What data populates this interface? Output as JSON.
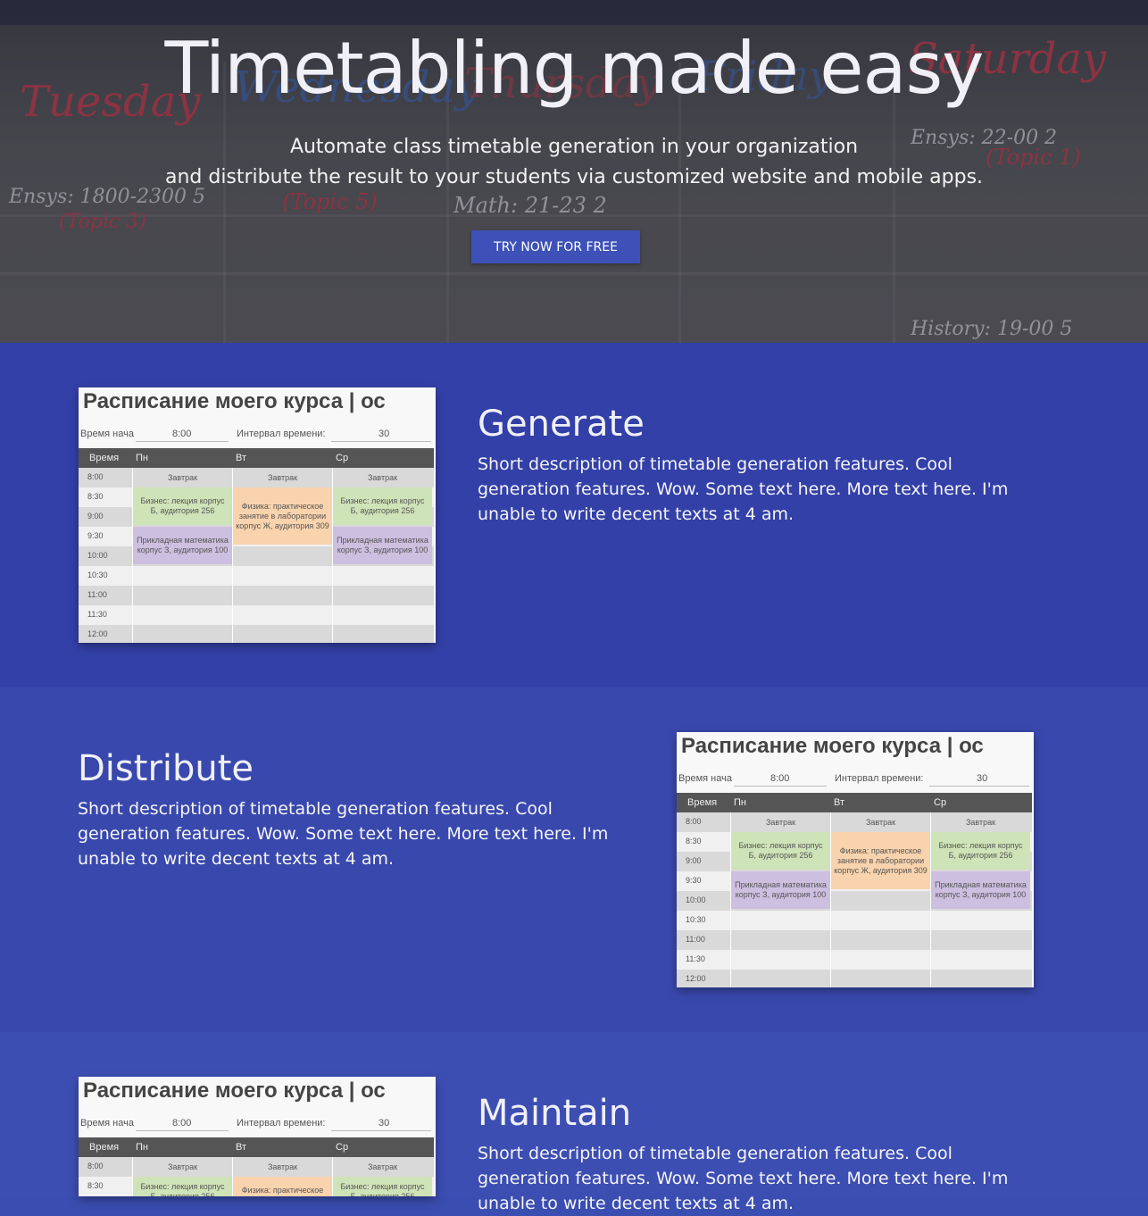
{
  "hero": {
    "title": "Timetabling made easy",
    "subtitle_line1": "Automate class timetable generation in your organization",
    "subtitle_line2": "and distribute the result to your students via customized website and mobile apps.",
    "cta_label": "TRY NOW FOR FREE",
    "background_scribbles": [
      "Tuesday",
      "Wednesday",
      "Thursday",
      "Friday",
      "Saturday",
      "Ensys: 1800-2300 5",
      "(Topic 3)",
      "(Topic 5)",
      "Math: 21-23 2",
      "Ensys: 22-00 2",
      "(Topic 1)",
      "History: 19-00 5"
    ]
  },
  "features": [
    {
      "title": "Generate",
      "description": "Short description of timetable generation features. Cool generation features. Wow. Some text here. More text here. I'm unable to write decent texts at 4 am."
    },
    {
      "title": "Distribute",
      "description": "Short description of timetable generation features. Cool generation features. Wow. Some text here. More text here. I'm unable to write decent texts at 4 am."
    },
    {
      "title": "Maintain",
      "description": "Short description of timetable generation features. Cool generation features. Wow. Some text here. More text here. I'm unable to write decent texts at 4 am."
    }
  ],
  "screenshot": {
    "title": "Расписание моего курса | ос",
    "start_label": "Время нача",
    "start_value": "8:00",
    "interval_label": "Интервал времени:",
    "interval_value": "30",
    "headers": [
      "Время",
      "Пн",
      "Вт",
      "Ср"
    ],
    "times": [
      "8:00",
      "8:30",
      "9:00",
      "9:30",
      "10:00",
      "10:30",
      "11:00",
      "11:30",
      "12:00"
    ],
    "breakfast": "Завтрак",
    "business": "Бизнес: лекция корпус Б, аудитория 256",
    "physics": "Физика: практическое занятие в лаборатории корпус Ж, аудитория 309",
    "math": "Прикладная математика корпус З, аудитория 100"
  },
  "colors": {
    "section1": "#3340a8",
    "section2": "#3948ad",
    "section3": "#3d4eb3",
    "cta": "#3d51b8",
    "green": "#cfe3b8",
    "orange": "#f8d3ad",
    "purple": "#cdbfe0"
  }
}
